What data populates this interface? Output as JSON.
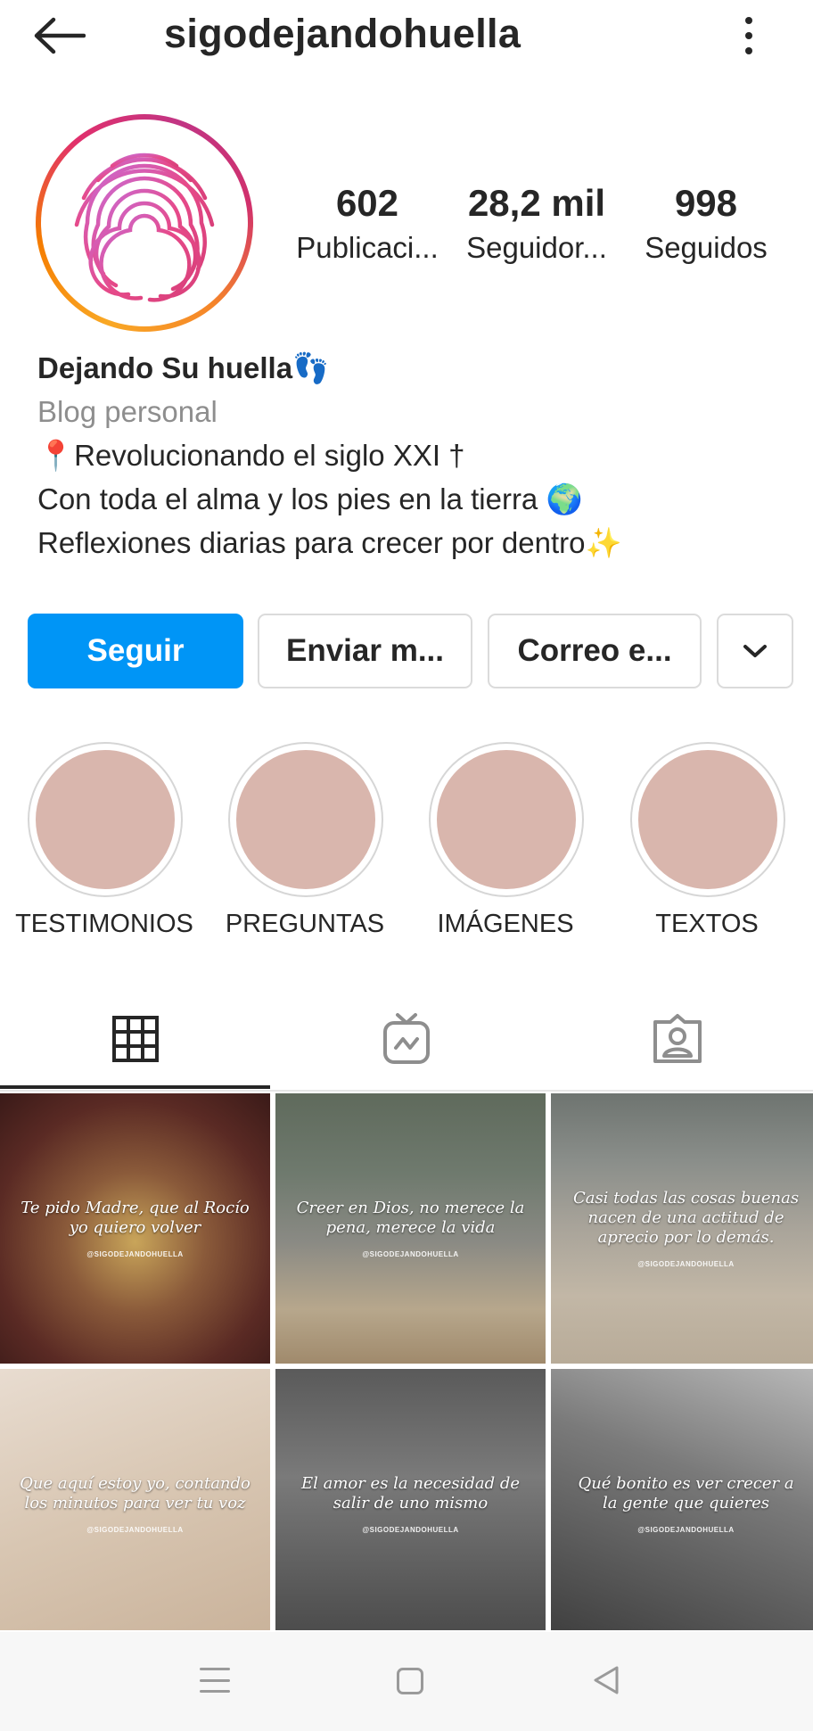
{
  "header": {
    "username": "sigodejandohuella",
    "back_icon": "arrow-left-icon",
    "more_icon": "vertical-dots-icon"
  },
  "profile": {
    "avatar_icon": "fingerprint-icon",
    "stats": [
      {
        "value": "602",
        "label": "Publicaci..."
      },
      {
        "value": "28,2 mil",
        "label": "Seguidor..."
      },
      {
        "value": "998",
        "label": "Seguidos"
      }
    ],
    "name": "Dejando Su huella👣",
    "category": "Blog personal",
    "bio_lines": [
      "📍Revolucionando el siglo XXI †",
      "Con toda el alma y los pies en la tierra 🌍",
      "Reflexiones diarias para crecer por dentro✨"
    ]
  },
  "actions": {
    "follow": "Seguir",
    "message": "Enviar m...",
    "email": "Correo e...",
    "more_icon": "chevron-down-icon",
    "follow_color": "#0095f6"
  },
  "highlights": [
    {
      "label": "TESTIMONIOS"
    },
    {
      "label": "PREGUNTAS"
    },
    {
      "label": "IMÁGENES"
    },
    {
      "label": "TEXTOS"
    }
  ],
  "highlight_color": "#d9b6ad",
  "tabs": [
    {
      "icon": "grid-icon",
      "active": true
    },
    {
      "icon": "igtv-icon",
      "active": false
    },
    {
      "icon": "tagged-user-icon",
      "active": false
    }
  ],
  "posts": [
    {
      "quote": "Te pido Madre, que al Rocío yo quiero volver",
      "handle": "@SIGODEJANDOHUELLA"
    },
    {
      "quote": "Creer en Dios, no merece la pena, merece la vida",
      "handle": "@SIGODEJANDOHUELLA"
    },
    {
      "quote": "Casi todas las cosas buenas nacen de una actitud de aprecio por lo demás.",
      "handle": "@SIGODEJANDOHUELLA"
    },
    {
      "quote": "Que aquí estoy yo, contando los minutos para ver tu voz",
      "handle": "@SIGODEJANDOHUELLA"
    },
    {
      "quote": "El amor es la necesidad de salir de uno mismo",
      "handle": "@SIGODEJANDOHUELLA"
    },
    {
      "quote": "Qué bonito es ver crecer a la gente que quieres",
      "handle": "@SIGODEJANDOHUELLA"
    }
  ],
  "system_nav": {
    "menu_icon": "menu-lines-icon",
    "home_icon": "square-home-icon",
    "back_icon": "triangle-back-icon"
  }
}
